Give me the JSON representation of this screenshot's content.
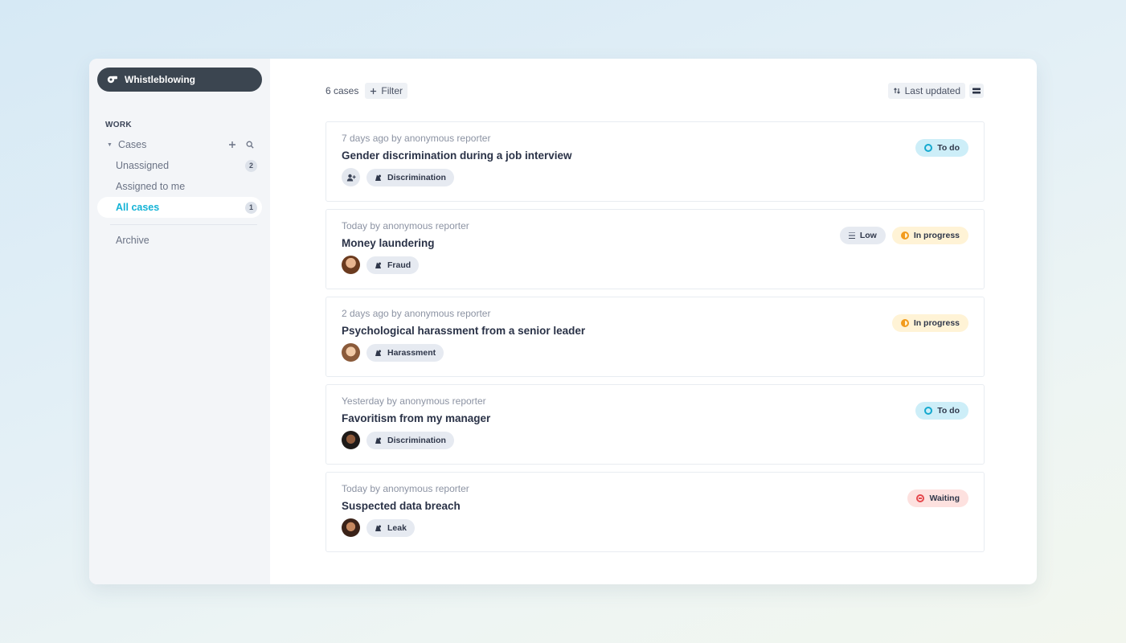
{
  "sidebar": {
    "workspace": "Whistleblowing",
    "section": "WORK",
    "cases_label": "Cases",
    "items": [
      {
        "label": "Unassigned",
        "count": "2"
      },
      {
        "label": "Assigned to me",
        "count": ""
      },
      {
        "label": "All cases",
        "count": "1"
      }
    ],
    "archive": "Archive"
  },
  "toolbar": {
    "count": "6 cases",
    "filter": "Filter",
    "sort": "Last updated"
  },
  "cases": [
    {
      "meta": "7 days ago by anonymous reporter",
      "title": "Gender discrimination during a job interview",
      "category": "Discrimination",
      "priority": "",
      "status": "To do",
      "avatar": "add-assignee-icon"
    },
    {
      "meta": "Today by anonymous reporter",
      "title": "Money laundering",
      "category": "Fraud",
      "priority": "Low",
      "status": "In progress",
      "avatar": "assignee-avatar"
    },
    {
      "meta": "2 days ago by anonymous reporter",
      "title": "Psychological harassment from a senior leader",
      "category": "Harassment",
      "priority": "",
      "status": "In progress",
      "avatar": "assignee-avatar"
    },
    {
      "meta": "Yesterday by anonymous reporter",
      "title": "Favoritism from my manager",
      "category": "Discrimination",
      "priority": "",
      "status": "To do",
      "avatar": "assignee-avatar"
    },
    {
      "meta": "Today by anonymous reporter",
      "title": "Suspected data breach",
      "category": "Leak",
      "priority": "",
      "status": "Waiting",
      "avatar": "assignee-avatar"
    }
  ],
  "colors": {
    "accent": "#14b3d6",
    "sidebar_bg": "#f3f5f8",
    "workspace_bg": "#3b4550",
    "todo": "#cdeef8",
    "in_progress": "#fff3d6",
    "waiting": "#fde1df"
  }
}
